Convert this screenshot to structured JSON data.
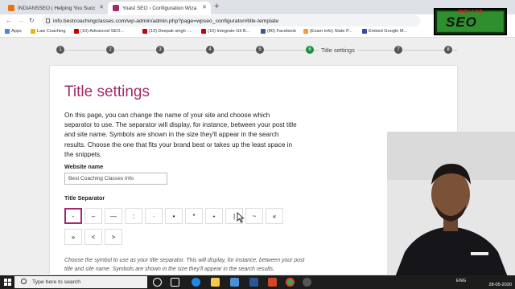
{
  "browser": {
    "tabs": [
      {
        "title": "INDIANSSEO | Helping You Succ",
        "favicon_color": "#e8710a"
      },
      {
        "title": "Yoast SEO › Configuration Wiza",
        "favicon_color": "#a4286a"
      }
    ],
    "new_tab": "+",
    "url": "info.bestcoachingclasses.com/wp-admin/admin.php?page=wpseo_configurator#title-template",
    "bookmarks": [
      {
        "label": "Apps",
        "color": "#4285f4"
      },
      {
        "label": "Law Coaching",
        "color": "#f4b400"
      },
      {
        "label": "(10) Advanced SEO...",
        "color": "#cc0000"
      },
      {
        "label": "(10) Deepak singh -...",
        "color": "#cc0000"
      },
      {
        "label": "(10) Integrate Git B...",
        "color": "#cc0000"
      },
      {
        "label": "(80) Facebook",
        "color": "#3b5998"
      },
      {
        "label": "(Exam Info) State P...",
        "color": "#ff9933"
      },
      {
        "label": "Embed Google M...",
        "color": "#3949ab"
      }
    ]
  },
  "wizard": {
    "steps": [
      "1",
      "2",
      "3",
      "4",
      "5",
      "6",
      "7",
      "8"
    ],
    "active_step": 6,
    "active_label": "Title settings"
  },
  "card": {
    "title": "Title settings",
    "intro": "On this page, you can change the name of your site and choose which separator to use. The separator will display, for instance, between your post title and site name. Symbols are shown in the size they'll appear in the search results. Choose the one that fits your brand best or takes up the least space in the snippets.",
    "website_name_label": "Website name",
    "website_name_value": "Best Coaching Classes Info",
    "separator_label": "Title Separator",
    "separators": [
      "-",
      "–",
      "—",
      ":",
      "·",
      "•",
      "*",
      "⋆",
      "|",
      "~",
      "«",
      "»",
      "<",
      ">"
    ],
    "selected_separator": "-",
    "help": "Choose the symbol to use as your title separator. This will display, for instance, between your post title and site name. Symbols are shown in the size they'll appear in the search results."
  },
  "logo": {
    "top": "INDIANS",
    "main": "SEO"
  },
  "taskbar": {
    "search_placeholder": "Type here to search",
    "lang": "ENG",
    "time": "",
    "date": "28-05-2020"
  }
}
